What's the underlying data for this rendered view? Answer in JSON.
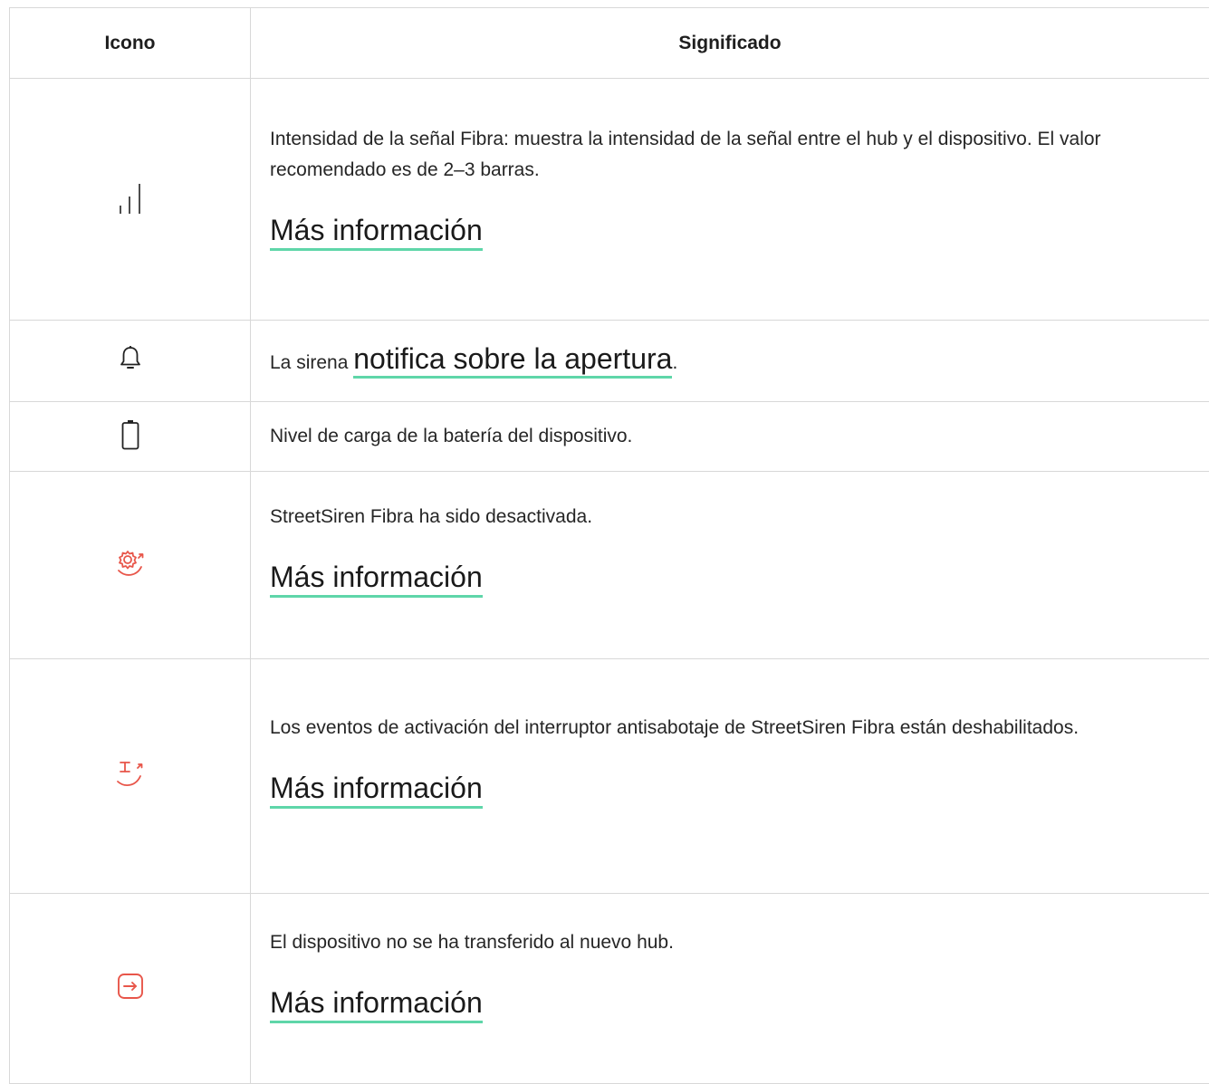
{
  "table": {
    "headers": {
      "icon": "Icono",
      "meaning": "Significado"
    },
    "rows": [
      {
        "icon": "signal-strength-icon",
        "description": "Intensidad de la señal Fibra: muestra la intensidad de la señal entre el hub y el dispositivo. El valor recomendado es de 2–3 barras.",
        "link": "Más información"
      },
      {
        "icon": "bell-icon",
        "prefix": "La sirena ",
        "link": "notifica sobre la apertura",
        "suffix": "."
      },
      {
        "icon": "battery-icon",
        "description": "Nivel de carga de la batería del dispositivo."
      },
      {
        "icon": "gear-deactivated-icon",
        "description": "StreetSiren Fibra ha sido desactivada.",
        "link": "Más información"
      },
      {
        "icon": "tamper-disabled-icon",
        "description": "Los eventos de activación del interruptor antisabotaje de StreetSiren Fibra están deshabilitados.",
        "link": "Más información"
      },
      {
        "icon": "transfer-arrow-icon",
        "description": "El dispositivo no se ha transferido al nuevo hub.",
        "link": "Más información"
      }
    ]
  },
  "colors": {
    "accent_underline": "#5fd6a9",
    "warning_icon": "#e8564a",
    "border": "#d8d8d8"
  }
}
